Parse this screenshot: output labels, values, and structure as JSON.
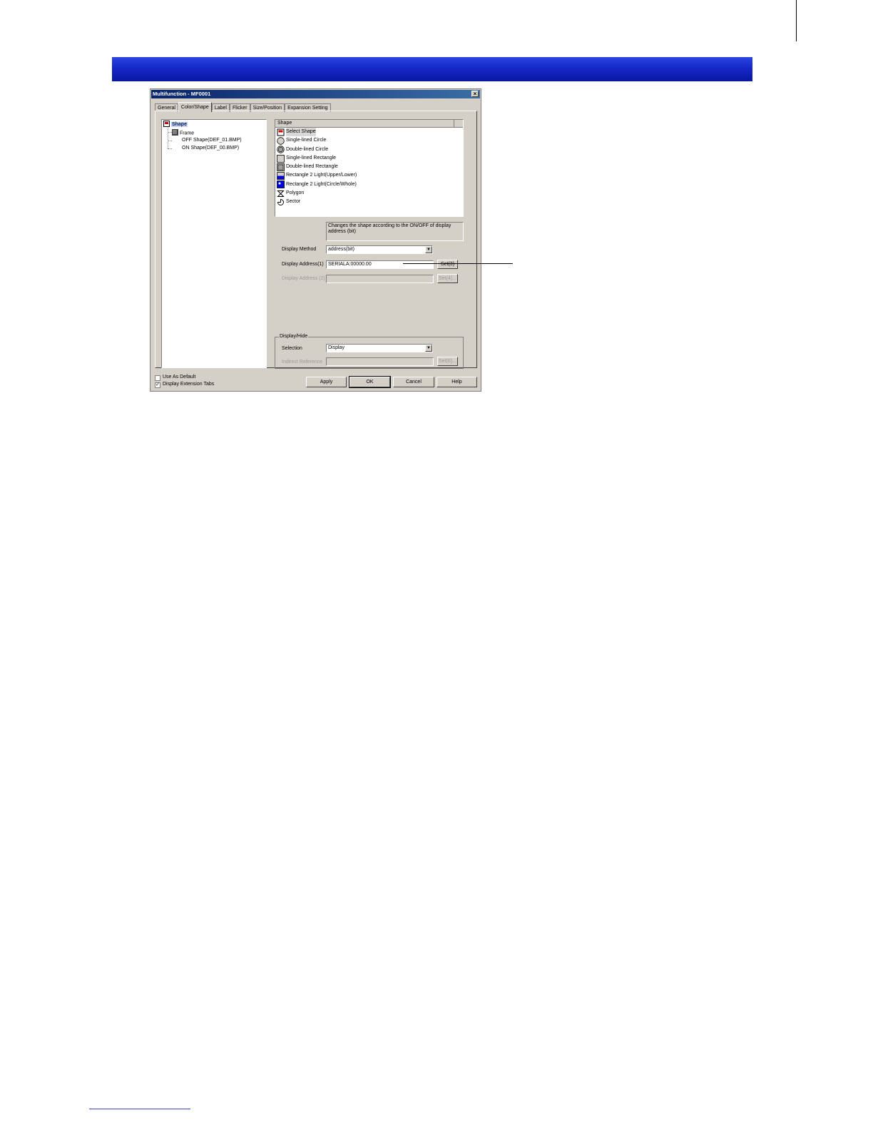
{
  "dialog": {
    "title": "Multifunction - MF0001",
    "close_glyph": "×"
  },
  "tabs": [
    {
      "label": "General"
    },
    {
      "label": "Color/Shape"
    },
    {
      "label": "Label"
    },
    {
      "label": "Flicker"
    },
    {
      "label": "Size/Position"
    },
    {
      "label": "Expansion Setting"
    }
  ],
  "tree": {
    "root": "Shape",
    "frame": "Frame",
    "off_shape": "OFF Shape(DEF_01.BMP)",
    "on_shape": "ON Shape(DEF_00.BMP)"
  },
  "shape_list": {
    "header": "Shape",
    "items": [
      {
        "label": "Select Shape",
        "icon": "select-shape-icon"
      },
      {
        "label": "Single-lined Circle",
        "icon": "single-circle-icon"
      },
      {
        "label": "Double-lined Circle",
        "icon": "double-circle-icon"
      },
      {
        "label": "Single-lined Rectangle",
        "icon": "single-rectangle-icon"
      },
      {
        "label": "Double-lined Rectangle",
        "icon": "double-rectangle-icon"
      },
      {
        "label": "Rectangle 2 Light(Upper/Lower)",
        "icon": "rect-2-light-upper-lower-icon"
      },
      {
        "label": "Rectangle 2 Light(Circle/Whole)",
        "icon": "rect-2-light-circle-whole-icon"
      },
      {
        "label": "Polygon",
        "icon": "polygon-icon"
      },
      {
        "label": "Sector",
        "icon": "sector-icon"
      }
    ]
  },
  "description": "Changes the shape according to the ON/OFF of display address (bit)",
  "display_method": {
    "label": "Display Method",
    "value": "address(bit)"
  },
  "display_address_1": {
    "label": "Display Address(1)",
    "value": "SERIALA:00000.00",
    "button": "Set(3)"
  },
  "display_address_2": {
    "label": "Display Address (2)",
    "value": "",
    "button": "Set(4)..."
  },
  "display_hide": {
    "group_title": "Display/Hide",
    "selection_label": "Selection",
    "selection_value": "Display",
    "indirect_label": "Indirect Reference",
    "indirect_value": "",
    "button": "Set(6)..."
  },
  "bottom": {
    "use_as_default": "Use As Default",
    "use_as_default_checked": false,
    "display_extension_tabs": "Display Extension Tabs",
    "display_extension_tabs_checked": true,
    "check_glyph": "✓",
    "apply": "Apply",
    "ok": "OK",
    "cancel": "Cancel",
    "help": "Help"
  },
  "colors": {
    "banner_blue": "#1428c8",
    "titlebar": "#0a246a",
    "dialog_face": "#d4d0c8"
  }
}
